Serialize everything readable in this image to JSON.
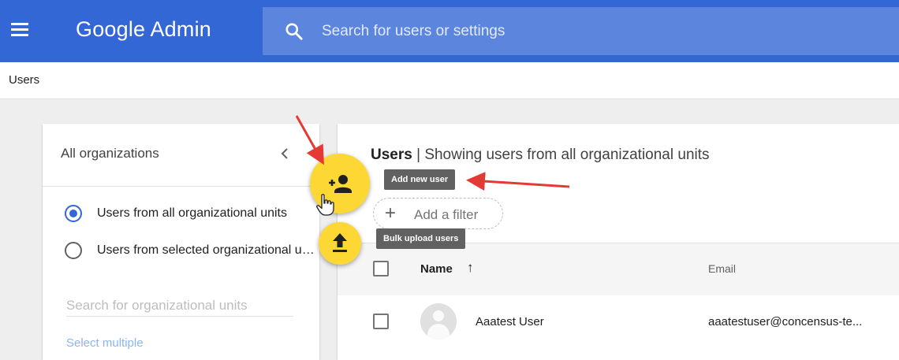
{
  "app": {
    "brand": "Google Admin"
  },
  "search": {
    "placeholder": "Search for users or settings"
  },
  "breadcrumb": {
    "current": "Users"
  },
  "org_panel": {
    "title": "All organizations",
    "options": [
      {
        "label": "Users from all organizational units",
        "selected": true
      },
      {
        "label": "Users from selected organizational units",
        "selected": false
      }
    ],
    "search_placeholder": "Search for organizational units",
    "select_multiple": "Select multiple"
  },
  "users_panel": {
    "heading_bold": "Users",
    "heading_rest": " | Showing users from all organizational units",
    "filter_label": "Add a filter",
    "columns": {
      "name": "Name",
      "email": "Email"
    },
    "rows": [
      {
        "name": "Aaatest User",
        "email": "aaatestuser@concensus-te..."
      }
    ]
  },
  "fabs": {
    "add_tooltip": "Add new user",
    "upload_tooltip": "Bulk upload users"
  },
  "colors": {
    "appbar": "#3367d6",
    "searchbar": "#5c85de",
    "fab": "#fdd835",
    "annotation_arrow": "#e53935"
  },
  "icons": [
    "menu-icon",
    "search-icon",
    "collapse-icon",
    "add-user-icon",
    "upload-icon",
    "sort-arrow-icon",
    "hand-cursor-icon"
  ]
}
